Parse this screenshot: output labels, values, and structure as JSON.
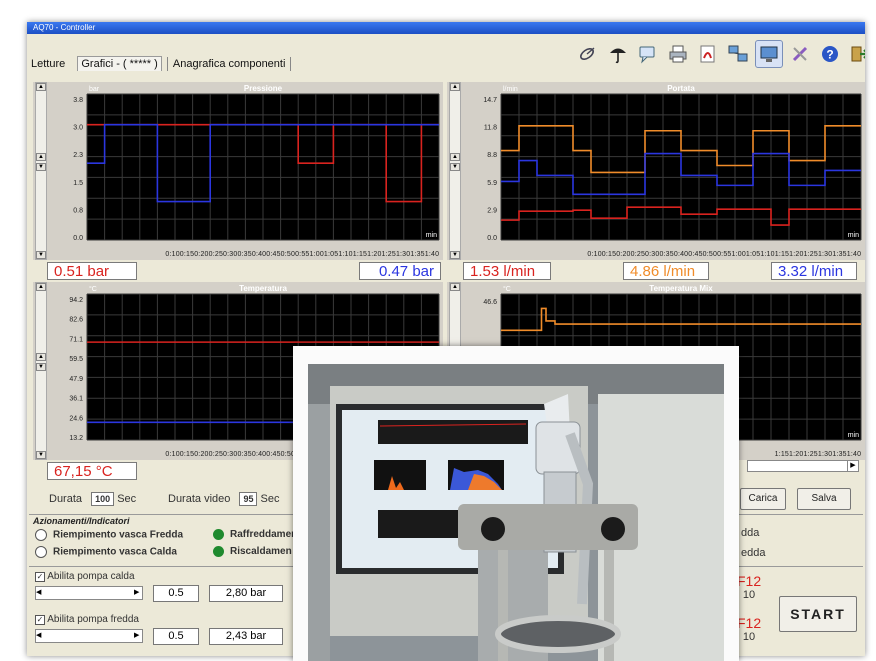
{
  "window": {
    "title": "AQ70 - Controller"
  },
  "tabs": {
    "letture": "Letture",
    "grafici": "Grafici - ( ***** )",
    "anagrafica": "Anagrafica componenti"
  },
  "toolbar_icons": [
    "satellite-dish-icon",
    "umbrella-icon",
    "chat-icon",
    "printer-icon",
    "pdf-icon",
    "network-icon",
    "monitor-icon",
    "tools-icon",
    "help-icon",
    "exit-icon"
  ],
  "colors": {
    "plot_bg": "#000000",
    "red": "#d9231f",
    "blue": "#2b36e0",
    "orange": "#f08c2a",
    "grid": "#3a3a3a",
    "frame": "#d4d0c8"
  },
  "charts": [
    {
      "title": "Pressione",
      "unit": "bar",
      "yticks": [
        "3.8",
        "3.0",
        "2.3",
        "1.5",
        "0.8",
        "0.0"
      ],
      "xlabel": "min",
      "xticks": "0:100:150:200:250:300:350:400:450:500:551:001:051:101:151:201:251:301:351:40"
    },
    {
      "title": "Portata",
      "unit": "l/min",
      "yticks": [
        "14.7",
        "11.8",
        "8.8",
        "5.9",
        "2.9",
        "0.0"
      ],
      "xlabel": "min",
      "xticks": "0:100:150:200:250:300:350:400:450:500:551:001:051:101:151:201:251:301:351:40"
    },
    {
      "title": "Temperatura",
      "unit": "°C",
      "yticks": [
        "94.2",
        "82.6",
        "71.1",
        "59.5",
        "47.9",
        "36.1",
        "24.6",
        "13.2"
      ],
      "xlabel": "min",
      "xticks": "0:100:150:200:250:300:350:400:450:500:551:001:051:101:151:201:251:301:351:40"
    },
    {
      "title": "Temperatura Mix",
      "unit": "°C",
      "yticks": [
        "46.6"
      ],
      "xlabel": "min",
      "xticks": "1:151:201:251:301:351:40"
    }
  ],
  "chart_data": [
    {
      "type": "line",
      "title": "Pressione",
      "ylabel": "bar",
      "xlabel": "min",
      "ylim": [
        0,
        3.8
      ],
      "x": [
        0,
        2,
        4,
        6,
        8,
        10,
        12,
        14,
        16,
        18,
        20,
        22,
        24,
        26,
        28,
        30,
        32,
        34,
        36,
        38,
        40
      ],
      "series": [
        {
          "color": "red",
          "values": [
            3.0,
            3.0,
            3.0,
            3.0,
            3.0,
            3.0,
            3.0,
            3.0,
            3.0,
            3.0,
            3.0,
            3.0,
            2.0,
            2.0,
            3.0,
            3.0,
            3.0,
            1.0,
            1.0,
            3.0,
            3.0
          ]
        },
        {
          "color": "blue",
          "values": [
            2.0,
            3.0,
            3.0,
            3.0,
            1.0,
            1.0,
            1.0,
            3.0,
            3.0,
            3.0,
            3.0,
            3.0,
            3.0,
            3.0,
            3.0,
            3.0,
            3.0,
            3.0,
            3.0,
            3.0,
            3.0
          ]
        }
      ]
    },
    {
      "type": "line",
      "title": "Portata",
      "ylabel": "l/min",
      "xlabel": "min",
      "ylim": [
        0,
        14.7
      ],
      "x": [
        0,
        2,
        4,
        6,
        8,
        10,
        12,
        14,
        16,
        18,
        20,
        22,
        24,
        26,
        28,
        30,
        32,
        34,
        36,
        38,
        40
      ],
      "series": [
        {
          "color": "orange",
          "values": [
            9.0,
            11.5,
            11.5,
            11.5,
            9.0,
            6.8,
            6.8,
            6.8,
            11.0,
            11.0,
            9.0,
            9.0,
            7.5,
            7.5,
            11.0,
            11.0,
            8.0,
            8.0,
            11.5,
            11.5,
            11.5
          ]
        },
        {
          "color": "blue",
          "values": [
            5.9,
            8.0,
            6.5,
            6.5,
            4.6,
            4.6,
            4.6,
            4.6,
            8.7,
            8.7,
            6.5,
            6.5,
            5.5,
            5.5,
            8.7,
            8.7,
            5.5,
            5.5,
            7.0,
            7.0,
            7.0
          ]
        },
        {
          "color": "red",
          "values": [
            2.0,
            2.9,
            2.9,
            2.9,
            3.0,
            2.2,
            2.2,
            3.3,
            3.3,
            3.3,
            2.6,
            2.6,
            3.1,
            3.1,
            3.1,
            1.5,
            3.1,
            3.1,
            3.1,
            3.1,
            3.1
          ]
        }
      ]
    },
    {
      "type": "line",
      "title": "Temperatura",
      "ylabel": "°C",
      "xlabel": "min",
      "ylim": [
        13.2,
        94.2
      ],
      "x": [
        0,
        40
      ],
      "series": [
        {
          "color": "red",
          "values": [
            67.5,
            67.5
          ]
        },
        {
          "color": "blue",
          "values": [
            23.0,
            23.0
          ]
        }
      ]
    },
    {
      "type": "line",
      "title": "Temperatura Mix",
      "ylabel": "°C",
      "xlabel": "min",
      "ylim": [
        0,
        46.6
      ],
      "x": [
        0,
        4,
        4.5,
        5,
        6,
        40
      ],
      "series": [
        {
          "color": "orange",
          "values": [
            35,
            35,
            42,
            38,
            37,
            37
          ]
        }
      ]
    }
  ],
  "readouts": {
    "p_red": "0.51 bar",
    "p_blue": "0.47 bar",
    "f_red": "1.53 l/min",
    "f_orange": "4.86 l/min",
    "f_blue": "3.32 l/min",
    "t_red": "67,15 °C"
  },
  "controls": {
    "durata_label": "Durata",
    "durata_value": "100",
    "sec": "Sec",
    "durata_video_label": "Durata video",
    "durata_video_value": "95",
    "sec2": "Sec",
    "carica": "Carica",
    "salva": "Salva",
    "group_title": "Azionamenti/Indicatori",
    "riempimento_fredda": "Riempimento vasca Fredda",
    "riempimento_calda": "Riempimento vasca Calda",
    "raffreddamento": "Raffreddamen",
    "riscaldamento": "Riscaldamen",
    "right_1": "dda",
    "right_2": "edda",
    "abilita_calda": "Abilita pompa calda",
    "abilita_fredda": "Abilita pompa fredda",
    "calda_step": "0.5",
    "calda_value": "2,80 bar",
    "fredda_step": "0.5",
    "fredda_value": "2,43 bar",
    "f12_a": "F12",
    "f12_a_val": "10",
    "f12_b": "F12",
    "f12_b_val": "10",
    "start": "START"
  }
}
